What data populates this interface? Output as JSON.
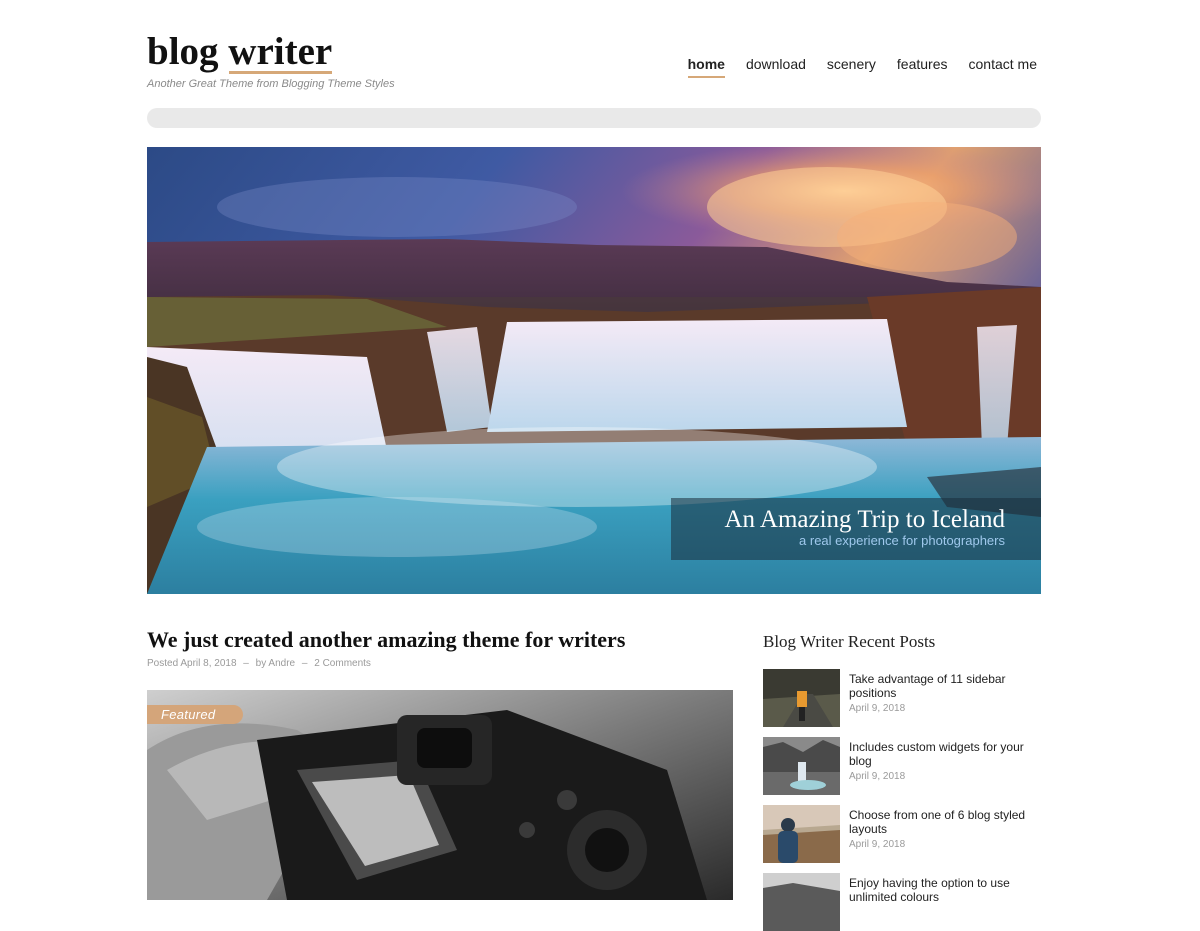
{
  "header": {
    "site_title_1": "blog",
    "site_title_2": "writer",
    "tagline": "Another Great Theme from Blogging Theme Styles"
  },
  "nav": {
    "items": [
      "home",
      "download",
      "scenery",
      "features",
      "contact me"
    ],
    "active": "home"
  },
  "hero": {
    "title": "An Amazing Trip to Iceland",
    "subtitle": "a real experience for photographers"
  },
  "post": {
    "title": "We just created another amazing theme for writers",
    "posted": "Posted April 8, 2018",
    "sep1": "–",
    "author": "by Andre",
    "sep2": "–",
    "comments": "2 Comments",
    "badge": "Featured"
  },
  "sidebar": {
    "title": "Blog Writer Recent Posts",
    "items": [
      {
        "title": "Take advantage of 11 sidebar positions",
        "date": "April 9, 2018"
      },
      {
        "title": "Includes custom widgets for your blog",
        "date": "April 9, 2018"
      },
      {
        "title": "Choose from one of 6 blog styled layouts",
        "date": "April 9, 2018"
      },
      {
        "title": "Enjoy having the option to use unlimited colours",
        "date": ""
      }
    ]
  },
  "colors": {
    "accent": "#d6a878",
    "badge": "#d4a57a",
    "hero_sub": "#9fc8ec"
  }
}
